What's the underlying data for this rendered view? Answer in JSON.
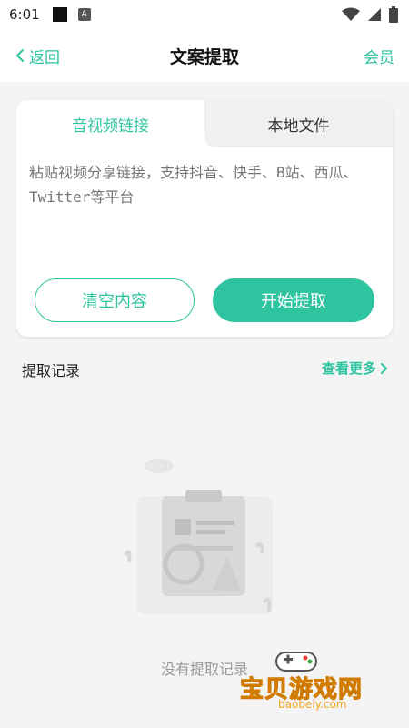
{
  "status_bar": {
    "time": "6:01",
    "small_icon_letter": "A"
  },
  "nav": {
    "back_label": "返回",
    "title": "文案提取",
    "member_label": "会员"
  },
  "tabs": [
    {
      "label": "音视频链接",
      "active": true
    },
    {
      "label": "本地文件",
      "active": false
    }
  ],
  "input": {
    "placeholder": "粘贴视频分享链接，支持抖音、快手、B站、西瓜、Twitter等平台",
    "value": ""
  },
  "buttons": {
    "clear_label": "清空内容",
    "start_label": "开始提取"
  },
  "records": {
    "title": "提取记录",
    "more_label": "查看更多",
    "empty_text": "没有提取记录"
  },
  "watermark": {
    "title": "宝贝游戏网",
    "url": "baobeiy.com"
  },
  "colors": {
    "accent": "#2ec4a0",
    "background": "#f4f4f4"
  }
}
